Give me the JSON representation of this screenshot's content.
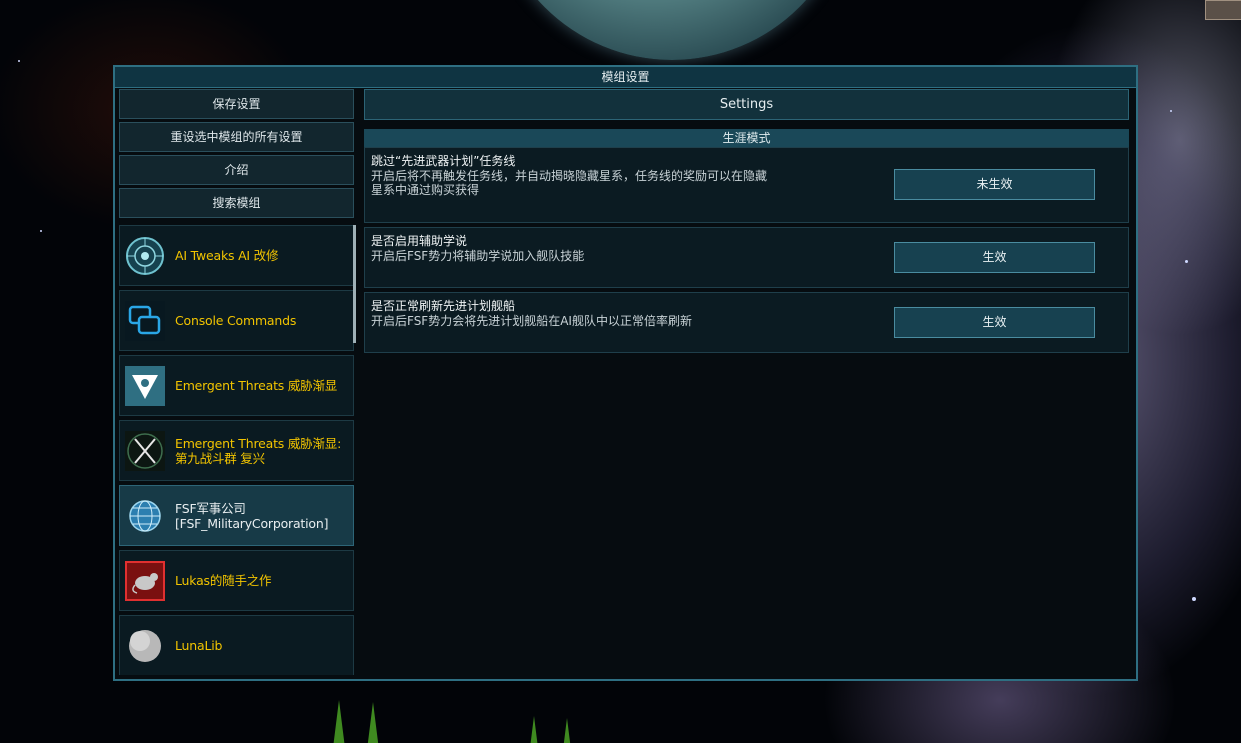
{
  "dialog": {
    "title": "模组设置"
  },
  "sidebar": {
    "buttons": [
      {
        "label": "保存设置"
      },
      {
        "label": "重设选中模组的所有设置"
      },
      {
        "label": "介绍"
      },
      {
        "label": "搜索模组"
      }
    ]
  },
  "mods": [
    {
      "name": "AI Tweaks AI 改修",
      "icon": "circuit-brain-icon",
      "color": "#f2c400"
    },
    {
      "name": "Console Commands",
      "icon": "console-windows-icon",
      "color": "#f2c400"
    },
    {
      "name": "Emergent Threats 威胁渐显",
      "icon": "emergent-threats-icon",
      "color": "#f2c400"
    },
    {
      "name": "Emergent Threats 威胁渐显: 第九战斗群 复兴",
      "icon": "crossed-swords-icon",
      "color": "#f2c400"
    },
    {
      "name": "FSF军事公司[FSF_MilitaryCorporation]",
      "icon": "globe-grid-icon",
      "color": "#e8eef0",
      "selected": true
    },
    {
      "name": "Lukas的随手之作",
      "icon": "rat-icon",
      "color": "#f2c400"
    },
    {
      "name": "LunaLib",
      "icon": "moon-icon",
      "color": "#f2c400"
    }
  ],
  "settings": {
    "header": "Settings",
    "category": "生涯模式",
    "items": [
      {
        "title": "跳过“先进武器计划”任务线",
        "desc_line1": "开启后将不再触发任务线，并自动揭晓隐藏星系，任务线的奖励可以在隐藏",
        "desc_line2": "星系中通过购买获得",
        "value": "未生效"
      },
      {
        "title": "是否启用辅助学说",
        "desc_line1": "开启后FSF势力将辅助学说加入舰队技能",
        "desc_line2": "",
        "value": "生效"
      },
      {
        "title": "是否正常刷新先进计划舰船",
        "desc_line1": "开启后FSF势力会将先进计划舰船在AI舰队中以正常倍率刷新",
        "desc_line2": "",
        "value": "生效"
      }
    ]
  },
  "colors": {
    "accent": "#2e6f82",
    "mod_name": "#f2c400",
    "panel": "#060c10"
  }
}
